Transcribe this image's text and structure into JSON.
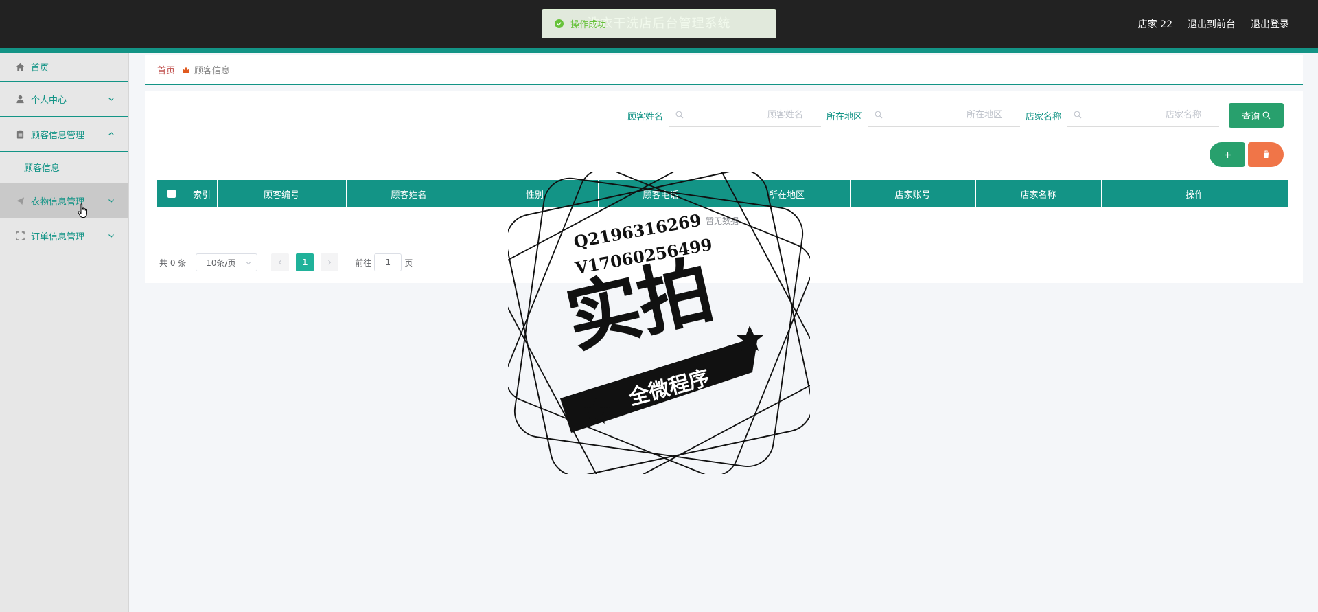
{
  "header": {
    "title": "洗衣干洗店后台管理系统",
    "user": "店家 22",
    "to_front": "退出到前台",
    "logout": "退出登录"
  },
  "toast": {
    "message": "操作成功"
  },
  "sidebar": {
    "items": [
      {
        "label": "首页"
      },
      {
        "label": "个人中心"
      },
      {
        "label": "顾客信息管理"
      },
      {
        "label": "顾客信息"
      },
      {
        "label": "衣物信息管理"
      },
      {
        "label": "订单信息管理"
      }
    ]
  },
  "breadcrumb": {
    "home": "首页",
    "current": "顾客信息"
  },
  "search": {
    "name_label": "顾客姓名",
    "name_placeholder": "顾客姓名",
    "region_label": "所在地区",
    "region_placeholder": "所在地区",
    "shop_label": "店家名称",
    "shop_placeholder": "店家名称",
    "query_button": "查询"
  },
  "table": {
    "columns": [
      "索引",
      "顾客编号",
      "顾客姓名",
      "性别",
      "顾客电话",
      "所在地区",
      "店家账号",
      "店家名称",
      "操作"
    ],
    "empty_text": "暂无数据"
  },
  "pagination": {
    "total": "共 0 条",
    "page_size": "10条/页",
    "current_page": "1",
    "goto_prefix": "前往",
    "goto_value": "1",
    "goto_suffix": "页"
  },
  "watermark": {
    "line1": "Q2196316269",
    "line2": "V17060256499",
    "big": "实拍",
    "banner": "全微程序"
  },
  "colors": {
    "accent": "#139486",
    "topbar": "#222222",
    "query_button": "#28a06d",
    "delete_button": "#f07548",
    "page_active": "#20b29a",
    "toast_text": "#67c23a"
  }
}
